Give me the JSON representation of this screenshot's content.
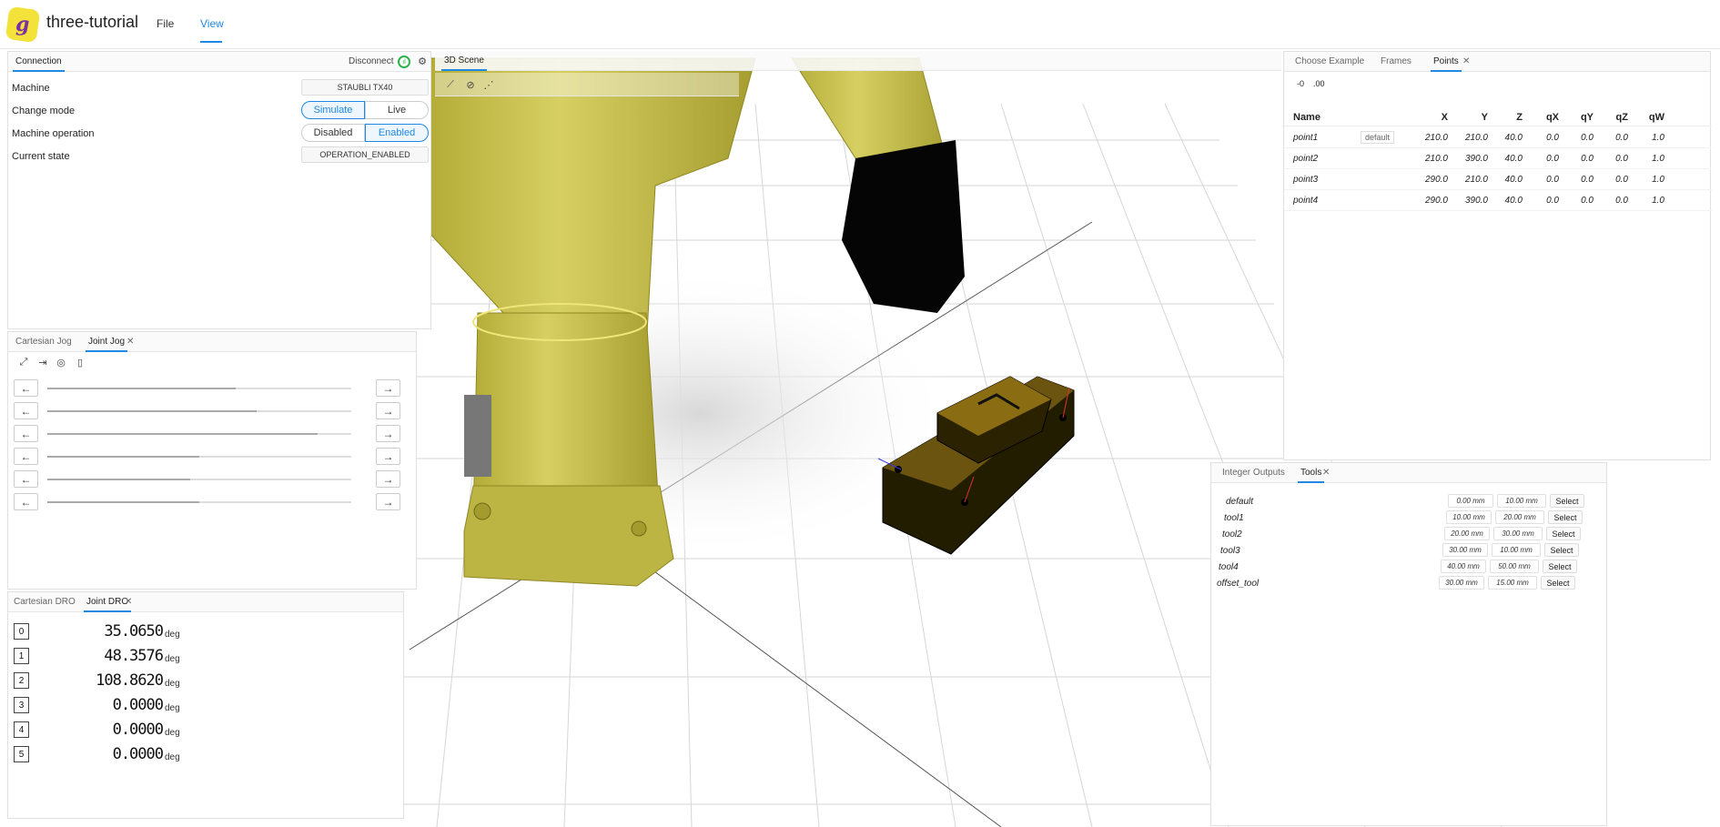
{
  "app": {
    "title": "three-tutorial",
    "logo_letter": "g",
    "menu": [
      "File",
      "View"
    ]
  },
  "connection": {
    "tab": "Connection",
    "disconnect_label": "Disconnect",
    "rows": {
      "machine_label": "Machine",
      "machine_value": "STAUBLI TX40",
      "mode_label": "Change mode",
      "mode_options": [
        "Simulate",
        "Live"
      ],
      "mode_selected": "Simulate",
      "op_label": "Machine operation",
      "op_options": [
        "Disabled",
        "Enabled"
      ],
      "op_selected": "Enabled",
      "state_label": "Current state",
      "state_value": "OPERATION_ENABLED"
    }
  },
  "jog": {
    "tabs": [
      "Cartesian Jog",
      "Joint Jog"
    ],
    "active_tab": "Joint Jog",
    "joints": [
      0.62,
      0.69,
      0.89,
      0.5,
      0.47,
      0.5
    ]
  },
  "dro": {
    "tabs": [
      "Cartesian DRO",
      "Joint DRO"
    ],
    "active_tab": "Joint DRO",
    "unit": "deg",
    "rows": [
      {
        "index": "0",
        "value": "35.0650"
      },
      {
        "index": "1",
        "value": "48.3576"
      },
      {
        "index": "2",
        "value": "108.8620"
      },
      {
        "index": "3",
        "value": "0.0000"
      },
      {
        "index": "4",
        "value": "0.0000"
      },
      {
        "index": "5",
        "value": "0.0000"
      }
    ]
  },
  "scene": {
    "tab": "3D Scene"
  },
  "points": {
    "tabs": [
      "Choose Example",
      "Frames",
      "Points"
    ],
    "active_tab": "Points",
    "toolbar": [
      "-0",
      ".00"
    ],
    "headers": [
      "Name",
      "X",
      "Y",
      "Z",
      "qX",
      "qY",
      "qZ",
      "qW"
    ],
    "default_badge": "default",
    "rows": [
      [
        "point1",
        "210.0",
        "210.0",
        "40.0",
        "0.0",
        "0.0",
        "0.0",
        "1.0"
      ],
      [
        "point2",
        "210.0",
        "390.0",
        "40.0",
        "0.0",
        "0.0",
        "0.0",
        "1.0"
      ],
      [
        "point3",
        "290.0",
        "210.0",
        "40.0",
        "0.0",
        "0.0",
        "0.0",
        "1.0"
      ],
      [
        "point4",
        "290.0",
        "390.0",
        "40.0",
        "0.0",
        "0.0",
        "0.0",
        "1.0"
      ]
    ]
  },
  "tools": {
    "tabs": [
      "Integer Outputs",
      "Tools"
    ],
    "active_tab": "Tools",
    "select_label": "Select",
    "rows": [
      {
        "name": "default",
        "a": "0.00 mm",
        "b": "10.00 mm"
      },
      {
        "name": "tool1",
        "a": "10.00 mm",
        "b": "20.00 mm"
      },
      {
        "name": "tool2",
        "a": "20.00 mm",
        "b": "30.00 mm"
      },
      {
        "name": "tool3",
        "a": "30.00 mm",
        "b": "10.00 mm"
      },
      {
        "name": "tool4",
        "a": "40.00 mm",
        "b": "50.00 mm"
      },
      {
        "name": "offset_tool",
        "a": "30.00 mm",
        "b": "15.00 mm"
      }
    ]
  },
  "colors": {
    "accent": "#1e88e5",
    "robot": "#c8c050",
    "part": "#2a2200"
  }
}
